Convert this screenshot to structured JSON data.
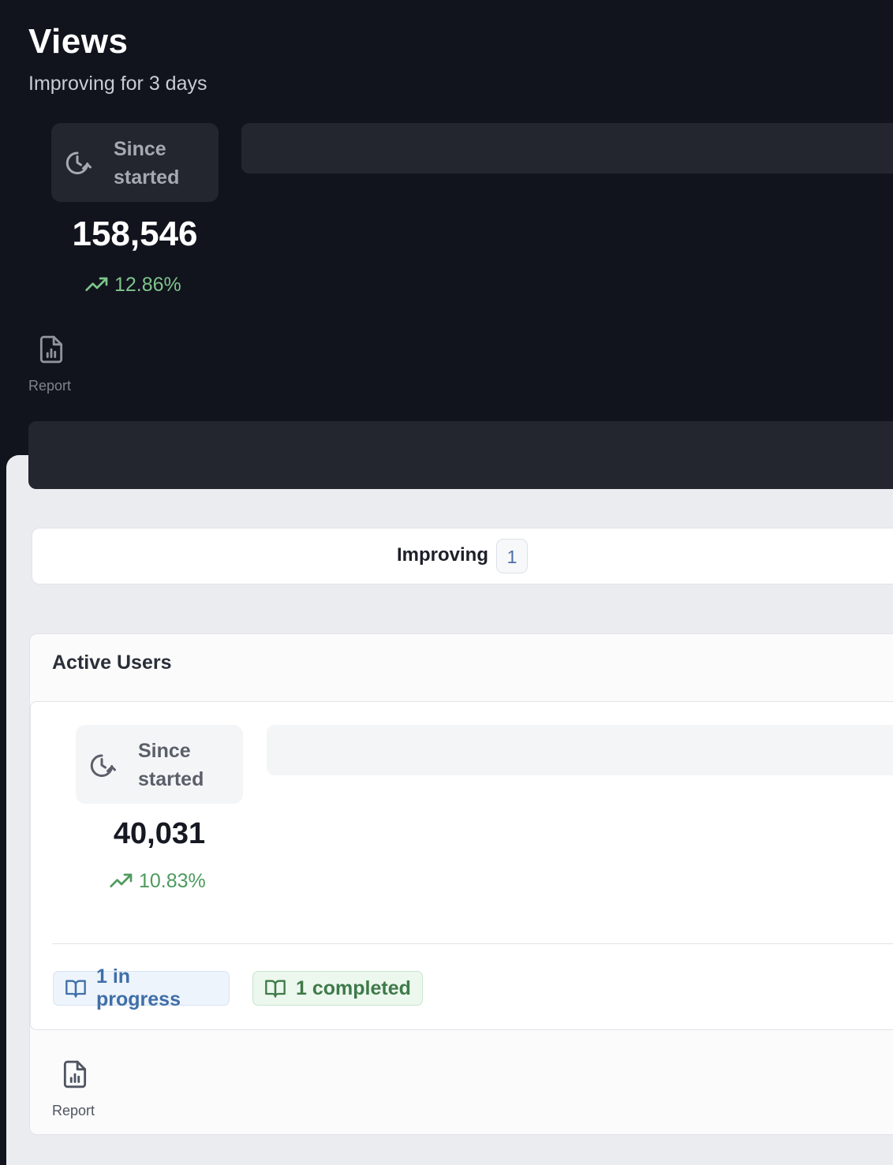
{
  "views": {
    "title": "Views",
    "subtitle": "Improving for 3 days",
    "period_label_line1": "Since",
    "period_label_line2": "started",
    "value": "158,546",
    "trend": "12.86%",
    "report_label": "Report"
  },
  "tabs": {
    "improving_label": "Improving",
    "improving_count": "1"
  },
  "active_users": {
    "title": "Active Users",
    "period_label_line1": "Since",
    "period_label_line2": "started",
    "value": "40,031",
    "trend": "10.83%",
    "in_progress": "1 in progress",
    "completed": "1 completed",
    "report_label": "Report"
  },
  "colors": {
    "dark_bg": "#11131d",
    "trend_green_dark": "#7ec58b",
    "trend_green_light": "#4e9a5e",
    "chip_blue": "#3f6fa8",
    "chip_green": "#3e7a4a"
  },
  "icons": {
    "period": "clock-refresh-icon",
    "trend": "trending-up-icon",
    "report": "file-chart-icon",
    "chip": "open-book-icon"
  }
}
